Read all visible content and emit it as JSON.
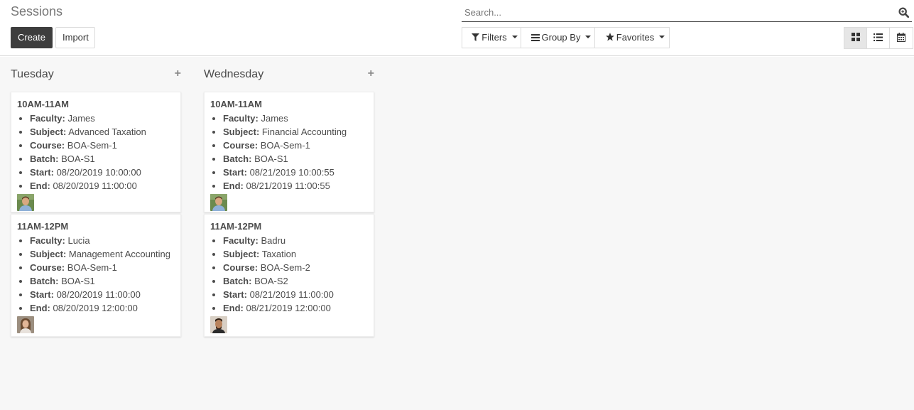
{
  "header": {
    "title": "Sessions",
    "create_label": "Create",
    "import_label": "Import"
  },
  "search": {
    "placeholder": "Search..."
  },
  "filters": {
    "filters_label": "Filters",
    "group_by_label": "Group By",
    "favorites_label": "Favorites"
  },
  "views": [
    "kanban",
    "list",
    "calendar"
  ],
  "columns": [
    {
      "title": "Tuesday",
      "cards": [
        {
          "time": "10AM-11AM",
          "faculty_label": "Faculty:",
          "faculty": "James",
          "subject_label": "Subject:",
          "subject": "Advanced Taxation",
          "course_label": "Course:",
          "course": "BOA-Sem-1",
          "batch_label": "Batch:",
          "batch": "BOA-S1",
          "start_label": "Start:",
          "start": "08/20/2019 10:00:00",
          "end_label": "End:",
          "end": "08/20/2019 11:00:00"
        },
        {
          "time": "11AM-12PM",
          "faculty_label": "Faculty:",
          "faculty": "Lucia",
          "subject_label": "Subject:",
          "subject": "Management Accounting",
          "course_label": "Course:",
          "course": "BOA-Sem-1",
          "batch_label": "Batch:",
          "batch": "BOA-S1",
          "start_label": "Start:",
          "start": "08/20/2019 11:00:00",
          "end_label": "End:",
          "end": "08/20/2019 12:00:00"
        }
      ]
    },
    {
      "title": "Wednesday",
      "cards": [
        {
          "time": "10AM-11AM",
          "faculty_label": "Faculty:",
          "faculty": "James",
          "subject_label": "Subject:",
          "subject": "Financial Accounting",
          "course_label": "Course:",
          "course": "BOA-Sem-1",
          "batch_label": "Batch:",
          "batch": "BOA-S1",
          "start_label": "Start:",
          "start": "08/21/2019 10:00:55",
          "end_label": "End:",
          "end": "08/21/2019 11:00:55"
        },
        {
          "time": "11AM-12PM",
          "faculty_label": "Faculty:",
          "faculty": "Badru",
          "subject_label": "Subject:",
          "subject": "Taxation",
          "course_label": "Course:",
          "course": "BOA-Sem-2",
          "batch_label": "Batch:",
          "batch": "BOA-S2",
          "start_label": "Start:",
          "start": "08/21/2019 11:00:00",
          "end_label": "End:",
          "end": "08/21/2019 12:00:00"
        }
      ]
    }
  ],
  "colors": {
    "create_bg": "#3d3d3d",
    "board_bg": "#f7f7f7",
    "active_view_bg": "#e6e6e6"
  }
}
